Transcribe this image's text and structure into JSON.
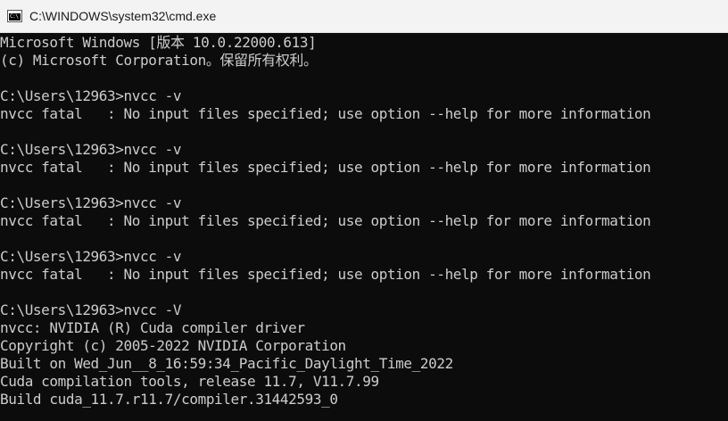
{
  "window": {
    "title": "C:\\WINDOWS\\system32\\cmd.exe",
    "icon": "cmd-console-icon",
    "icon_prompt": "C:\\"
  },
  "colors": {
    "console_background": "#0c0c0c",
    "console_text": "#cccccc",
    "titlebar_background": "#f3f3f3"
  },
  "console": {
    "lines": [
      "Microsoft Windows [版本 10.0.22000.613]",
      "(c) Microsoft Corporation。保留所有权利。",
      "C:\\Users\\12963>nvcc -v",
      "nvcc fatal   : No input files specified; use option --help for more information",
      "C:\\Users\\12963>nvcc -v",
      "nvcc fatal   : No input files specified; use option --help for more information",
      "C:\\Users\\12963>nvcc -v",
      "nvcc fatal   : No input files specified; use option --help for more information",
      "C:\\Users\\12963>nvcc -v",
      "nvcc fatal   : No input files specified; use option --help for more information",
      "C:\\Users\\12963>nvcc -V",
      "nvcc: NVIDIA (R) Cuda compiler driver",
      "Copyright (c) 2005-2022 NVIDIA Corporation",
      "Built on Wed_Jun__8_16:59:34_Pacific_Daylight_Time_2022",
      "Cuda compilation tools, release 11.7, V11.7.99",
      "Build cuda_11.7.r11.7/compiler.31442593_0"
    ]
  }
}
